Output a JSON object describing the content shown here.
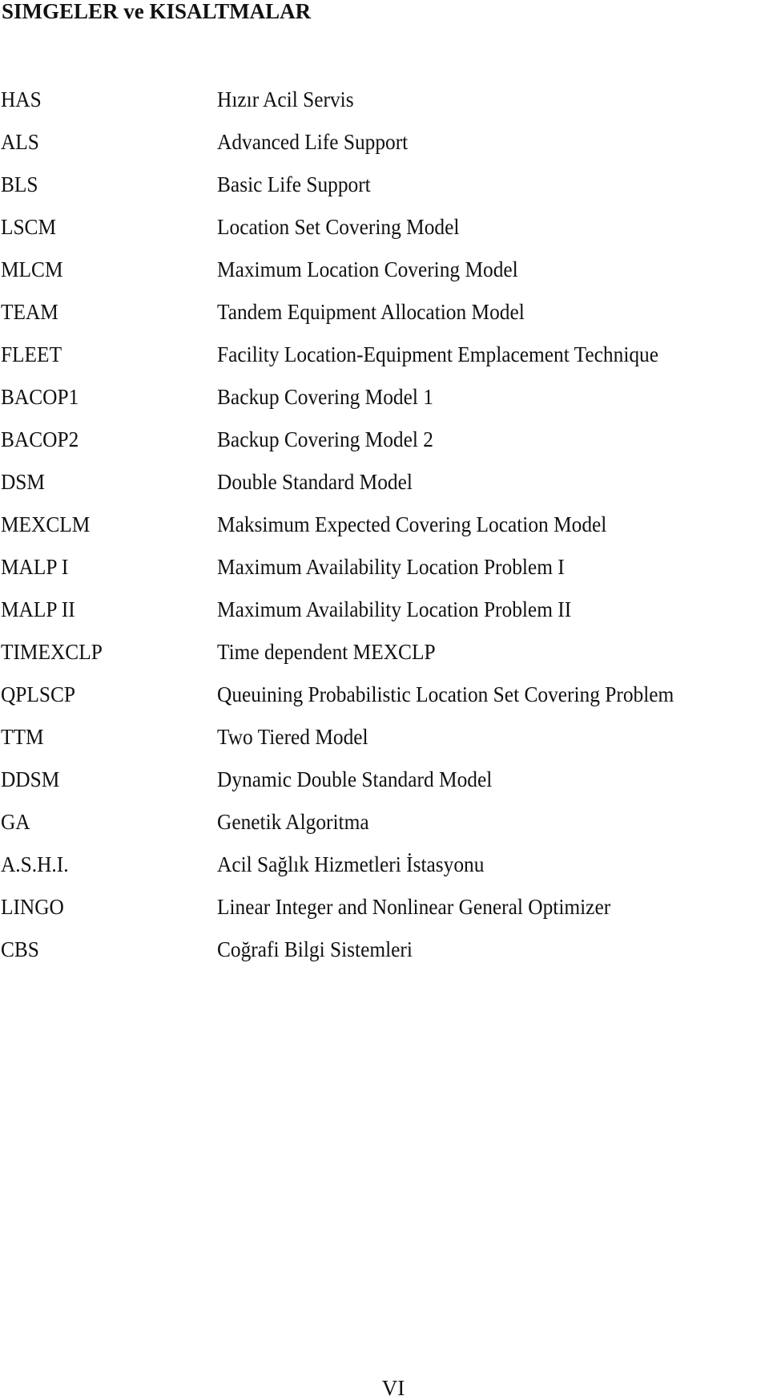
{
  "document": {
    "title": "SIMGELER ve KISALTMALAR",
    "page_number": "VI",
    "entries": [
      {
        "abbr": "HAS",
        "expansion": "Hızır Acil Servis"
      },
      {
        "abbr": "ALS",
        "expansion": "Advanced Life Support"
      },
      {
        "abbr": "BLS",
        "expansion": "Basic Life Support"
      },
      {
        "abbr": "LSCM",
        "expansion": "Location Set Covering Model"
      },
      {
        "abbr": "MLCM",
        "expansion": "Maximum Location Covering Model"
      },
      {
        "abbr": "TEAM",
        "expansion": "Tandem Equipment Allocation Model"
      },
      {
        "abbr": "FLEET",
        "expansion": "Facility Location-Equipment Emplacement Technique"
      },
      {
        "abbr": "BACOP1",
        "expansion": "Backup Covering Model 1"
      },
      {
        "abbr": "BACOP2",
        "expansion": "Backup Covering Model 2"
      },
      {
        "abbr": "DSM",
        "expansion": "Double Standard Model"
      },
      {
        "abbr": "MEXCLM",
        "expansion": "Maksimum Expected Covering Location Model"
      },
      {
        "abbr": "MALP I",
        "expansion": "Maximum Availability Location Problem I"
      },
      {
        "abbr": "MALP II",
        "expansion": "Maximum Availability Location Problem II"
      },
      {
        "abbr": "TIMEXCLP",
        "expansion": "Time dependent MEXCLP"
      },
      {
        "abbr": "QPLSCP",
        "expansion": "Queuining Probabilistic Location Set Covering Problem"
      },
      {
        "abbr": "TTM",
        "expansion": "Two Tiered Model"
      },
      {
        "abbr": "DDSM",
        "expansion": "Dynamic Double Standard Model"
      },
      {
        "abbr": "GA",
        "expansion": "Genetik Algoritma"
      },
      {
        "abbr": "A.S.H.I.",
        "expansion": "Acil Sağlık Hizmetleri İstasyonu"
      },
      {
        "abbr": "LINGO",
        "expansion": "Linear Integer and Nonlinear General Optimizer"
      },
      {
        "abbr": "CBS",
        "expansion": "Coğrafi Bilgi Sistemleri"
      }
    ]
  }
}
